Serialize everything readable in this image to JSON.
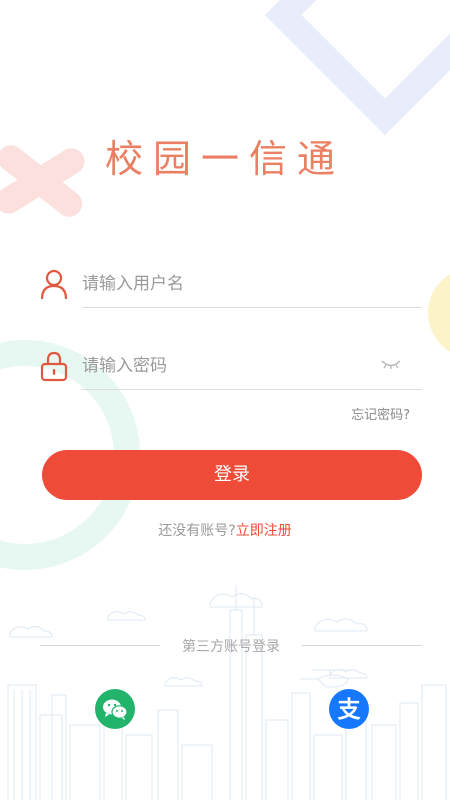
{
  "title": "校园一信通",
  "username": {
    "placeholder": "请输入用户名",
    "icon": "user-icon"
  },
  "password": {
    "placeholder": "请输入密码",
    "icon": "lock-icon",
    "toggle_icon": "eye-closed-icon"
  },
  "forgot_label": "忘记密码?",
  "login_label": "登录",
  "register": {
    "hint": "还没有账号?",
    "link": "立即注册"
  },
  "third_party": {
    "label": "第三方账号登录",
    "items": [
      {
        "name": "wechat",
        "icon": "wechat-icon"
      },
      {
        "name": "alipay",
        "icon": "alipay-icon",
        "glyph": "支"
      }
    ]
  },
  "colors": {
    "accent": "#ef4b39",
    "title": "#ea7f63",
    "wechat": "#23b46c",
    "alipay": "#1677ff"
  }
}
